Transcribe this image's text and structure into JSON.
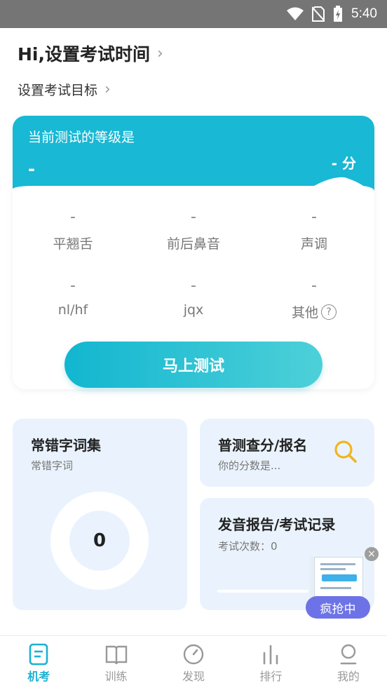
{
  "status_bar": {
    "time": "5:40",
    "icons": [
      "wifi-icon",
      "no-sim-icon",
      "battery-charging-icon"
    ]
  },
  "header": {
    "greeting": "Hi,设置考试时间",
    "goal": "设置考试目标"
  },
  "score_card": {
    "title": "当前测试的等级是",
    "level": "-",
    "score": "-",
    "score_unit": "分",
    "metrics": [
      {
        "value": "-",
        "label": "平翘舌"
      },
      {
        "value": "-",
        "label": "前后鼻音"
      },
      {
        "value": "-",
        "label": "声调"
      },
      {
        "value": "-",
        "label": "nl/hf"
      },
      {
        "value": "-",
        "label": "jqx"
      },
      {
        "value": "-",
        "label": "其他"
      }
    ],
    "help_icon": "?"
  },
  "test_button": "马上测试",
  "cards": {
    "mistakes": {
      "title": "常错字词集",
      "subtitle": "常错字词",
      "count": "0"
    },
    "query": {
      "title": "普测查分/报名",
      "subtitle": "你的分数是..."
    },
    "report": {
      "title": "发音报告/考试记录",
      "subtitle": "考试次数：0"
    }
  },
  "ad": {
    "label": "疯抢中",
    "close": "×"
  },
  "nav": [
    {
      "label": "机考",
      "icon": "exam-icon",
      "active": true
    },
    {
      "label": "训练",
      "icon": "book-icon",
      "active": false
    },
    {
      "label": "发现",
      "icon": "compass-icon",
      "active": false
    },
    {
      "label": "排行",
      "icon": "ranking-icon",
      "active": false
    },
    {
      "label": "我的",
      "icon": "profile-icon",
      "active": false
    }
  ],
  "colors": {
    "accent": "#19b8d4",
    "card_bg": "#eaf3fd",
    "ad_pill": "#6d73e6",
    "search_icon": "#f2b51d"
  }
}
